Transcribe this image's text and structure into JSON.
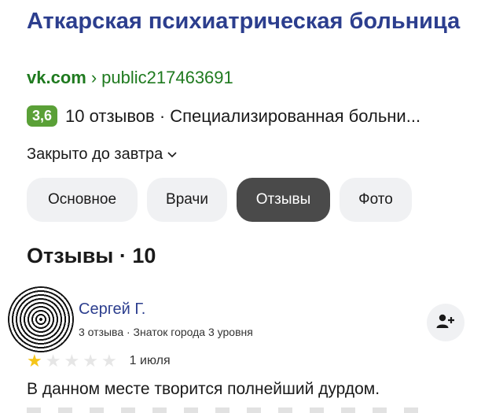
{
  "org": {
    "title": "Аткарская психиатрическая больница",
    "url_host": "vk.com",
    "url_separator": "›",
    "url_path": "public217463691",
    "rating": "3,6",
    "summary": "10 отзывов · Специализированная больни...",
    "hours": "Закрыто до завтра"
  },
  "tabs": [
    {
      "label": "Основное",
      "active": false
    },
    {
      "label": "Врачи",
      "active": false
    },
    {
      "label": "Отзывы",
      "active": true
    },
    {
      "label": "Фото",
      "active": false
    }
  ],
  "reviews_section": {
    "title": "Отзывы · 10"
  },
  "review": {
    "author": "Сергей Г.",
    "meta": "3 отзыва · Знаток города 3 уровня",
    "rating": 1,
    "rating_max": 5,
    "date": "1 июля",
    "text": "В данном месте творится полнейший дурдом."
  },
  "colors": {
    "title": "#2c3e8e",
    "url": "#1f7a1f",
    "rating_badge": "#5aa037",
    "active_tab": "#4a4a4a",
    "star_filled": "#f5c518"
  },
  "icons": {
    "hours_toggle": "chevron-down-icon",
    "follow": "add-user-icon",
    "star": "star-icon"
  }
}
